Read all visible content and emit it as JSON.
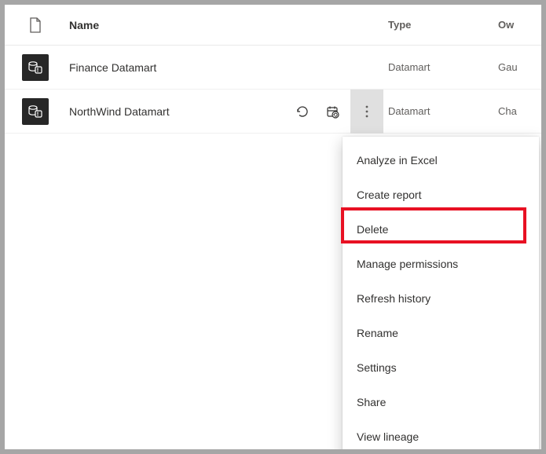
{
  "header": {
    "name": "Name",
    "type": "Type",
    "owner": "Ow"
  },
  "rows": [
    {
      "name": "Finance Datamart",
      "type": "Datamart",
      "owner": "Gau"
    },
    {
      "name": "NorthWind Datamart",
      "type": "Datamart",
      "owner": "Cha"
    }
  ],
  "menu": {
    "items": [
      {
        "label": "Analyze in Excel"
      },
      {
        "label": "Create report"
      },
      {
        "label": "Delete"
      },
      {
        "label": "Manage permissions"
      },
      {
        "label": "Refresh history"
      },
      {
        "label": "Rename"
      },
      {
        "label": "Settings"
      },
      {
        "label": "Share"
      },
      {
        "label": "View lineage"
      }
    ],
    "highlighted_index": 2
  }
}
